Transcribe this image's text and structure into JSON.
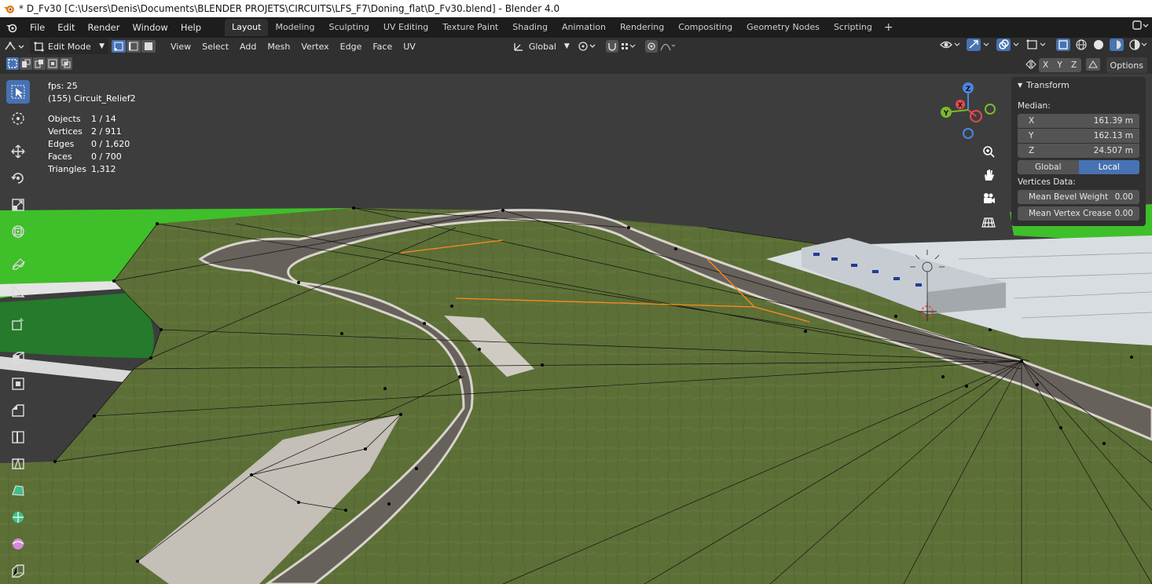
{
  "window": {
    "title": "* D_Fv30 [C:\\Users\\Denis\\Documents\\BLENDER PROJETS\\CIRCUITS\\LFS_F7\\Doning_flat\\D_Fv30.blend] - Blender 4.0"
  },
  "menu": {
    "items": [
      "File",
      "Edit",
      "Render",
      "Window",
      "Help"
    ]
  },
  "workspaces": {
    "tabs": [
      "Layout",
      "Modeling",
      "Sculpting",
      "UV Editing",
      "Texture Paint",
      "Shading",
      "Animation",
      "Rendering",
      "Compositing",
      "Geometry Nodes",
      "Scripting"
    ],
    "active": "Layout",
    "add": "+"
  },
  "header": {
    "mode": "Edit Mode",
    "menus": [
      "View",
      "Select",
      "Add",
      "Mesh",
      "Vertex",
      "Edge",
      "Face",
      "UV"
    ],
    "orientation": "Global",
    "axis_x": "X",
    "axis_y": "Y",
    "axis_z": "Z",
    "options": "Options"
  },
  "overlay": {
    "fps": "fps: 25",
    "object": "(155) Circuit_Relief2",
    "objects_label": "Objects",
    "objects_value": "1 / 14",
    "vertices_label": "Vertices",
    "vertices_value": "2 / 911",
    "edges_label": "Edges",
    "edges_value": "0 / 1,620",
    "faces_label": "Faces",
    "faces_value": "0 / 700",
    "triangles_label": "Triangles",
    "triangles_value": "1,312"
  },
  "gizmo": {
    "x": "X",
    "y": "Y",
    "z": "Z"
  },
  "npanel": {
    "title": "Transform",
    "median_label": "Median:",
    "x_label": "X",
    "x_value": "161.39 m",
    "y_label": "Y",
    "y_value": "162.13 m",
    "z_label": "Z",
    "z_value": "24.507 m",
    "global": "Global",
    "local": "Local",
    "vertices_data": "Vertices Data:",
    "bevel_label": "Mean Bevel Weight",
    "bevel_value": "0.00",
    "crease_label": "Mean Vertex Crease",
    "crease_value": "0.00"
  },
  "colors": {
    "accent": "#4772b3",
    "grass": "#5a6e36",
    "bright_green": "#3fbf2a",
    "road": "#5f5a55",
    "edge_select": "#ff8c1a"
  }
}
